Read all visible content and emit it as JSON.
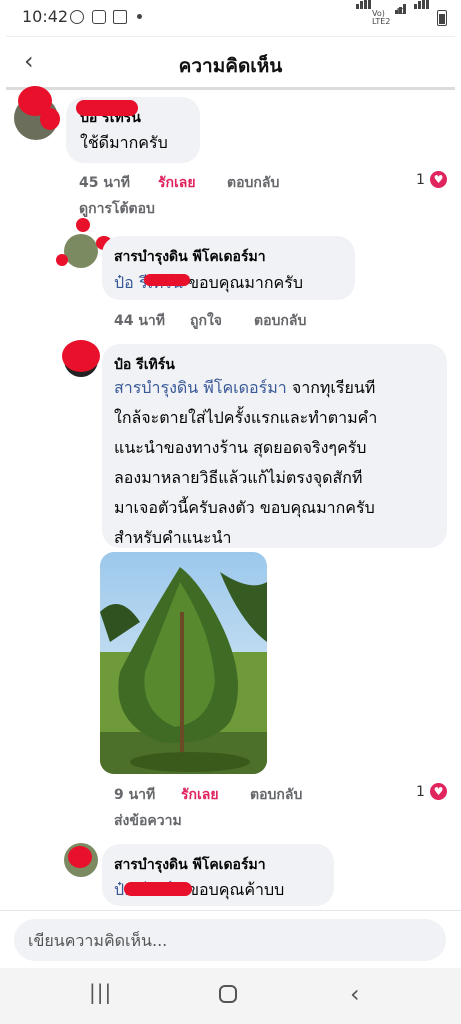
{
  "status": {
    "time": "10:42",
    "volte": "Vo) LTE2",
    "net": "4G"
  },
  "header": {
    "title": "ความคิดเห็น",
    "back_icon": "‹"
  },
  "comments": [
    {
      "name": "ป๋อ รีเทิร์น",
      "text": "ใช้ดีมากครับ",
      "time": "45 นาที",
      "like": "รักเลย",
      "reply": "ตอบกลับ",
      "reaction_count": "1",
      "view_replies": "ดูการโต้ตอบ"
    },
    {
      "name": "สารบำรุงดิน พีโคเดอร์มา",
      "mention": "ป๋อ รีเทิร์น",
      "text": " ขอบคุณมากครับ",
      "time": "44 นาที",
      "like": "ถูกใจ",
      "reply": "ตอบกลับ"
    },
    {
      "name": "ป๋อ รีเทิร์น",
      "mention": "สารบำรุงดิน พีโคเดอร์มา",
      "lines": [
        " จากทุเรียนที",
        "ใกล้จะตายใส่ไปครั้งแรกและทำตามคำ",
        "แนะนำของทางร้าน สุดยอดจริงๆครับ",
        "ลองมาหลายวิธีแล้วแก้ไม่ตรงจุดสักที",
        "มาเจอตัวนี้ครับลงตัว ขอบคุณมากครับ",
        "สำหรับคำแนะนำ"
      ],
      "time": "9 นาที",
      "like": "รักเลย",
      "reply": "ตอบกลับ",
      "reaction_count": "1",
      "send_message": "ส่งข้อความ"
    },
    {
      "name": "สารบำรุงดิน พีโคเดอร์มา",
      "mention": "ป๋อ รีเทิร์น",
      "text": " ขอบคุณค้าบบ"
    }
  ],
  "input": {
    "placeholder": "เขียนความคิดเห็น..."
  },
  "colors": {
    "accent": "#385898",
    "love": "#e0245e",
    "bubble": "#f0f2f5",
    "redact": "#e8102a"
  }
}
